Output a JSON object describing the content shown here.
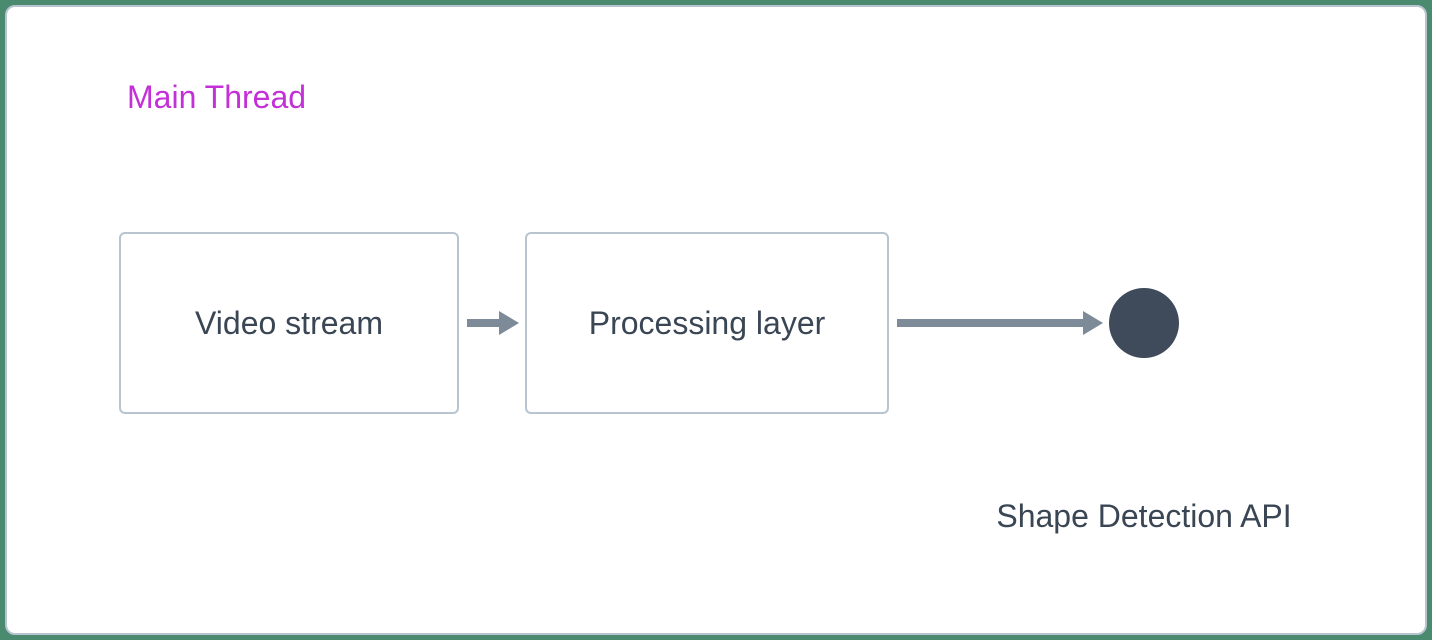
{
  "diagram": {
    "title": "Main Thread",
    "nodes": {
      "video_stream": "Video stream",
      "processing_layer": "Processing layer",
      "shape_detection_api": "Shape Detection API"
    },
    "colors": {
      "title": "#c430d8",
      "box_border": "#b8c4d0",
      "text": "#3a4654",
      "arrow": "#7d8a98",
      "circle": "#3f4b5a",
      "background_outer": "#4a8b6f"
    }
  }
}
